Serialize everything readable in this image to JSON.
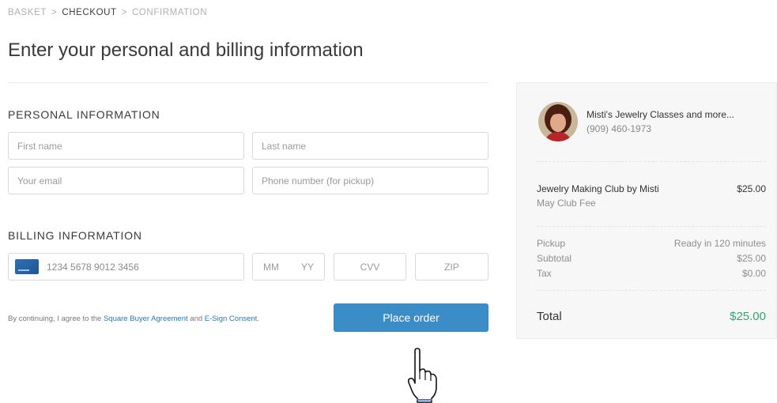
{
  "breadcrumb": {
    "steps": [
      "BASKET",
      "CHECKOUT",
      "CONFIRMATION"
    ],
    "separator": ">",
    "active_index": 1
  },
  "page_title": "Enter your personal and billing information",
  "personal": {
    "title": "PERSONAL INFORMATION",
    "first_name_placeholder": "First name",
    "last_name_placeholder": "Last name",
    "email_placeholder": "Your email",
    "phone_placeholder": "Phone number (for pickup)"
  },
  "billing": {
    "title": "BILLING INFORMATION",
    "card_icon": "credit-card-icon",
    "card_placeholder": "1234 5678 9012 3456",
    "month_placeholder": "MM",
    "year_placeholder": "YY",
    "cvv_placeholder": "CVV",
    "zip_placeholder": "ZIP"
  },
  "agreement": {
    "prefix": "By continuing, I agree to the ",
    "link1": "Square Buyer Agreement",
    "middle": " and ",
    "link2": "E-Sign Consent",
    "suffix": "."
  },
  "place_order_label": "Place order",
  "summary": {
    "merchant_name": "Misti's Jewelry Classes and more...",
    "merchant_phone": "(909) 460-1973",
    "item_name": "Jewelry Making Club by Misti",
    "item_price": "$25.00",
    "item_variant": "May Club Fee",
    "pickup_label": "Pickup",
    "pickup_value": "Ready in 120 minutes",
    "subtotal_label": "Subtotal",
    "subtotal_value": "$25.00",
    "tax_label": "Tax",
    "tax_value": "$0.00",
    "total_label": "Total",
    "total_value": "$25.00"
  },
  "colors": {
    "accent_button": "#3a8dc6",
    "link": "#2a79b4",
    "total_green": "#2eaa6d",
    "panel_bg": "#f7f7f7"
  }
}
